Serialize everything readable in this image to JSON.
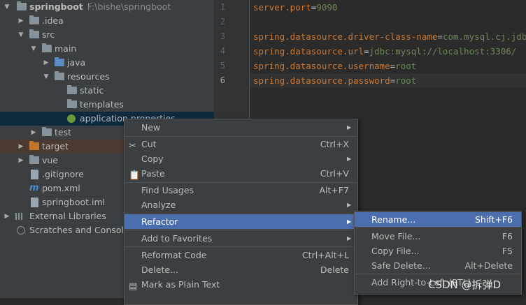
{
  "tree": {
    "items": [
      {
        "label": "springboot",
        "hint": "F:\\bishe\\springboot"
      },
      {
        "label": ".idea"
      },
      {
        "label": "src"
      },
      {
        "label": "main"
      },
      {
        "label": "java"
      },
      {
        "label": "resources"
      },
      {
        "label": "static"
      },
      {
        "label": "templates"
      },
      {
        "label": "application.properties"
      },
      {
        "label": "test"
      },
      {
        "label": "target"
      },
      {
        "label": "vue"
      },
      {
        "label": ".gitignore"
      },
      {
        "label": "pom.xml",
        "icon_text": "m"
      },
      {
        "label": "springboot.iml"
      },
      {
        "label": "External Libraries"
      },
      {
        "label": "Scratches and Consoles"
      }
    ]
  },
  "editor": {
    "line_numbers": [
      "1",
      "2",
      "3",
      "4",
      "5",
      "6"
    ],
    "lines": [
      {
        "key": "server.port",
        "eq": "=",
        "value": "9090"
      },
      {
        "key": "",
        "eq": "",
        "value": ""
      },
      {
        "key": "spring.datasource.driver-class-name",
        "eq": "=",
        "value": "com.mysql.cj.jdbc.Driver"
      },
      {
        "key": "spring.datasource.url",
        "eq": "=",
        "value": "jdbc:mysql://localhost:3306/"
      },
      {
        "key": "spring.datasource.username",
        "eq": "=",
        "value": "root"
      },
      {
        "key": "spring.datasource.password",
        "eq": "=",
        "value": "root"
      }
    ]
  },
  "context_menu": {
    "items": [
      {
        "label": "New",
        "shortcut": ""
      },
      {
        "label": "Cut",
        "shortcut": "Ctrl+X"
      },
      {
        "label": "Copy",
        "shortcut": ""
      },
      {
        "label": "Paste",
        "shortcut": "Ctrl+V"
      },
      {
        "label": "Find Usages",
        "shortcut": "Alt+F7"
      },
      {
        "label": "Analyze",
        "shortcut": ""
      },
      {
        "label": "Refactor",
        "shortcut": ""
      },
      {
        "label": "Add to Favorites",
        "shortcut": ""
      },
      {
        "label": "Reformat Code",
        "shortcut": "Ctrl+Alt+L"
      },
      {
        "label": "Delete...",
        "shortcut": "Delete"
      },
      {
        "label": "Mark as Plain Text",
        "shortcut": ""
      }
    ]
  },
  "refactor_menu": {
    "items": [
      {
        "label": "Rename...",
        "shortcut": "Shift+F6"
      },
      {
        "label": "Move File...",
        "shortcut": "F6"
      },
      {
        "label": "Copy File...",
        "shortcut": "F5"
      },
      {
        "label": "Safe Delete...",
        "shortcut": "Alt+Delete"
      },
      {
        "label": "Add Right-to-Left (RTL)"
      }
    ]
  },
  "watermark": "CSDN @拆弹D"
}
